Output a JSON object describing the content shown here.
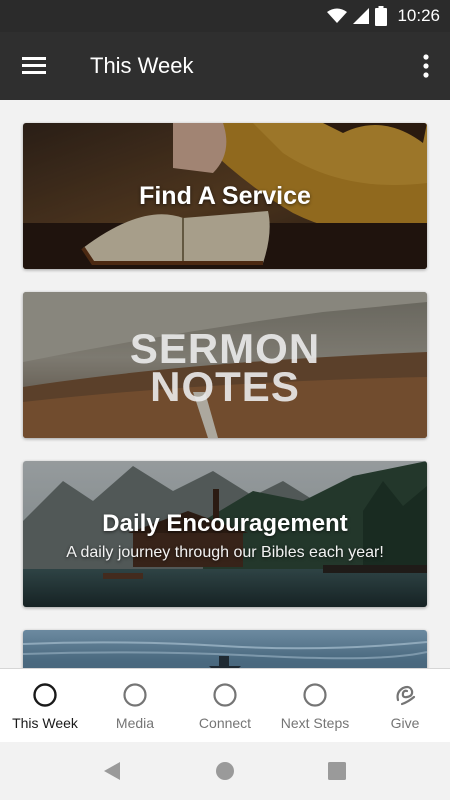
{
  "status_bar": {
    "time": "10:26",
    "icons": [
      "wifi-icon",
      "signal-icon",
      "battery-icon"
    ]
  },
  "app_bar": {
    "title": "This Week",
    "menu_icon": "hamburger-menu-icon",
    "more_icon": "more-vert-icon"
  },
  "cards": [
    {
      "title": "Find A Service"
    },
    {
      "title_line1": "SERMON",
      "title_line2": "NOTES"
    },
    {
      "title": "Daily Encouragement",
      "subtitle": "A daily journey through our Bibles each year!"
    },
    {
      "title": ""
    }
  ],
  "bottom_nav": {
    "items": [
      {
        "label": "This Week",
        "icon": "circle-icon",
        "active": true
      },
      {
        "label": "Media",
        "icon": "circle-icon"
      },
      {
        "label": "Connect",
        "icon": "circle-icon"
      },
      {
        "label": "Next Steps",
        "icon": "circle-icon"
      },
      {
        "label": "Give",
        "icon": "give-icon"
      }
    ]
  },
  "colors": {
    "app_bar": "#2f2f2f",
    "status_bar": "#2b2b2b",
    "nav_active": "#1a1a1a",
    "nav_inactive": "#757575"
  }
}
